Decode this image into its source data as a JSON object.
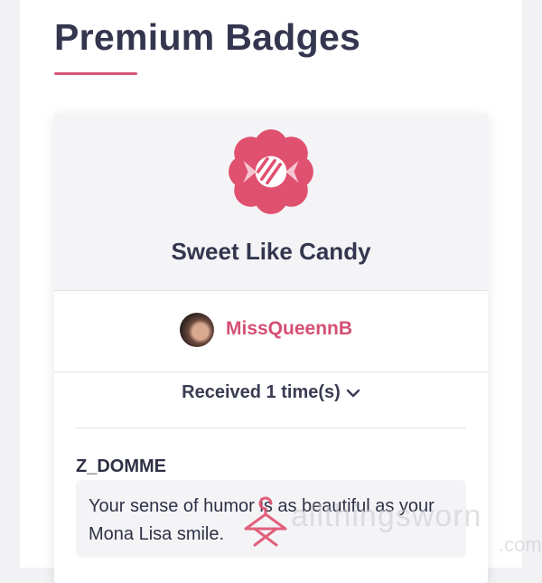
{
  "page": {
    "title": "Premium Badges",
    "accent_color": "#d6557a"
  },
  "badge": {
    "icon": "candy-icon",
    "icon_color": "#e0506f",
    "name": "Sweet Like Candy"
  },
  "sender": {
    "avatar": "user-avatar",
    "name": "MissQueennB",
    "name_color": "#d44f74"
  },
  "received": {
    "label": "Received 1 time(s)",
    "icon": "chevron-down-icon"
  },
  "entries": [
    {
      "giver": "Z_DOMME",
      "message": "Your sense of humor is as beautiful as your Mona Lisa smile."
    }
  ],
  "watermark": {
    "icon": "hanger-icon",
    "text": "allthingsworn",
    "suffix": ".com"
  }
}
